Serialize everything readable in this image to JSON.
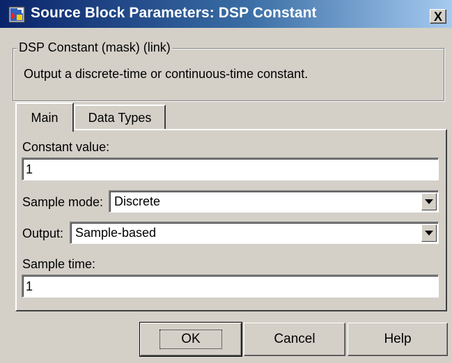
{
  "window": {
    "title": "Source Block Parameters: DSP Constant",
    "close_label": "X"
  },
  "group": {
    "legend": "DSP Constant (mask) (link)",
    "description": "Output a discrete-time or continuous-time constant."
  },
  "tabs": [
    {
      "label": "Main",
      "selected": true
    },
    {
      "label": "Data Types",
      "selected": false
    }
  ],
  "main": {
    "constant_value": {
      "label": "Constant value:",
      "value": "1"
    },
    "sample_mode": {
      "label": "Sample mode:",
      "value": "Discrete"
    },
    "output": {
      "label": "Output:",
      "value": "Sample-based"
    },
    "sample_time": {
      "label": "Sample time:",
      "value": "1"
    }
  },
  "buttons": {
    "ok": "OK",
    "cancel": "Cancel",
    "help": "Help"
  },
  "colors": {
    "titlebar_start": "#0a246a",
    "titlebar_end": "#a6caf0",
    "face": "#d4d0c8"
  }
}
